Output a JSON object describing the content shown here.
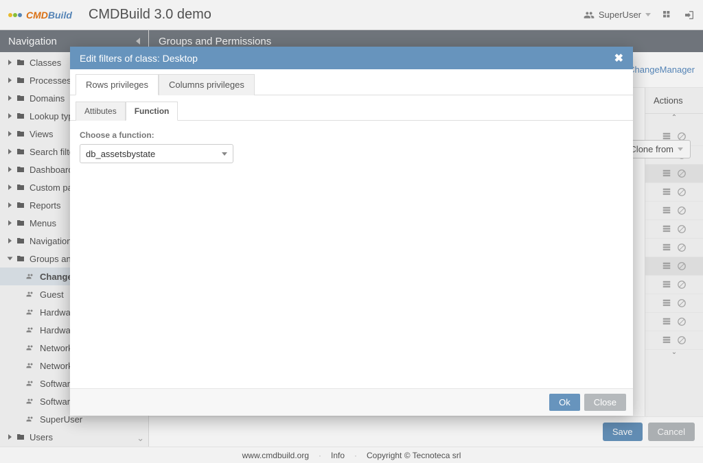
{
  "header": {
    "app_title": "CMDBuild 3.0 demo",
    "logo_cmd": "CMD",
    "logo_build": "Build",
    "user_label": "SuperUser"
  },
  "sidebar": {
    "title": "Navigation",
    "items": [
      {
        "label": "Classes"
      },
      {
        "label": "Processes"
      },
      {
        "label": "Domains"
      },
      {
        "label": "Lookup types"
      },
      {
        "label": "Views"
      },
      {
        "label": "Search filters"
      },
      {
        "label": "Dashboards"
      },
      {
        "label": "Custom pages"
      },
      {
        "label": "Reports"
      },
      {
        "label": "Menus"
      },
      {
        "label": "Navigation trees"
      }
    ],
    "groups_label": "Groups and permissions",
    "group_children": [
      {
        "label": "ChangeManager",
        "selected": true
      },
      {
        "label": "Guest"
      },
      {
        "label": "HardwareConfig"
      },
      {
        "label": "HardwareManager"
      },
      {
        "label": "NetworkConfig"
      },
      {
        "label": "NetworkManager"
      },
      {
        "label": "SoftwareConfig"
      },
      {
        "label": "SoftwareManager"
      },
      {
        "label": "SuperUser"
      }
    ],
    "users_label": "Users"
  },
  "content": {
    "title": "Groups and Permissions",
    "breadcrumb": "ChangeManager",
    "clone_label": "Clone from",
    "actions_header": "Actions",
    "save_label": "Save",
    "cancel_label": "Cancel"
  },
  "footer": {
    "site": "www.cmdbuild.org",
    "info": "Info",
    "copyright": "Copyright © Tecnoteca srl"
  },
  "modal": {
    "title": "Edit filters of class: Desktop",
    "tabs": [
      "Rows privileges",
      "Columns privileges"
    ],
    "active_tab": 0,
    "subtabs": [
      "Attibutes",
      "Function"
    ],
    "active_subtab": 1,
    "function_label": "Choose a function:",
    "function_value": "db_assetsbystate",
    "ok_label": "Ok",
    "close_label": "Close"
  }
}
